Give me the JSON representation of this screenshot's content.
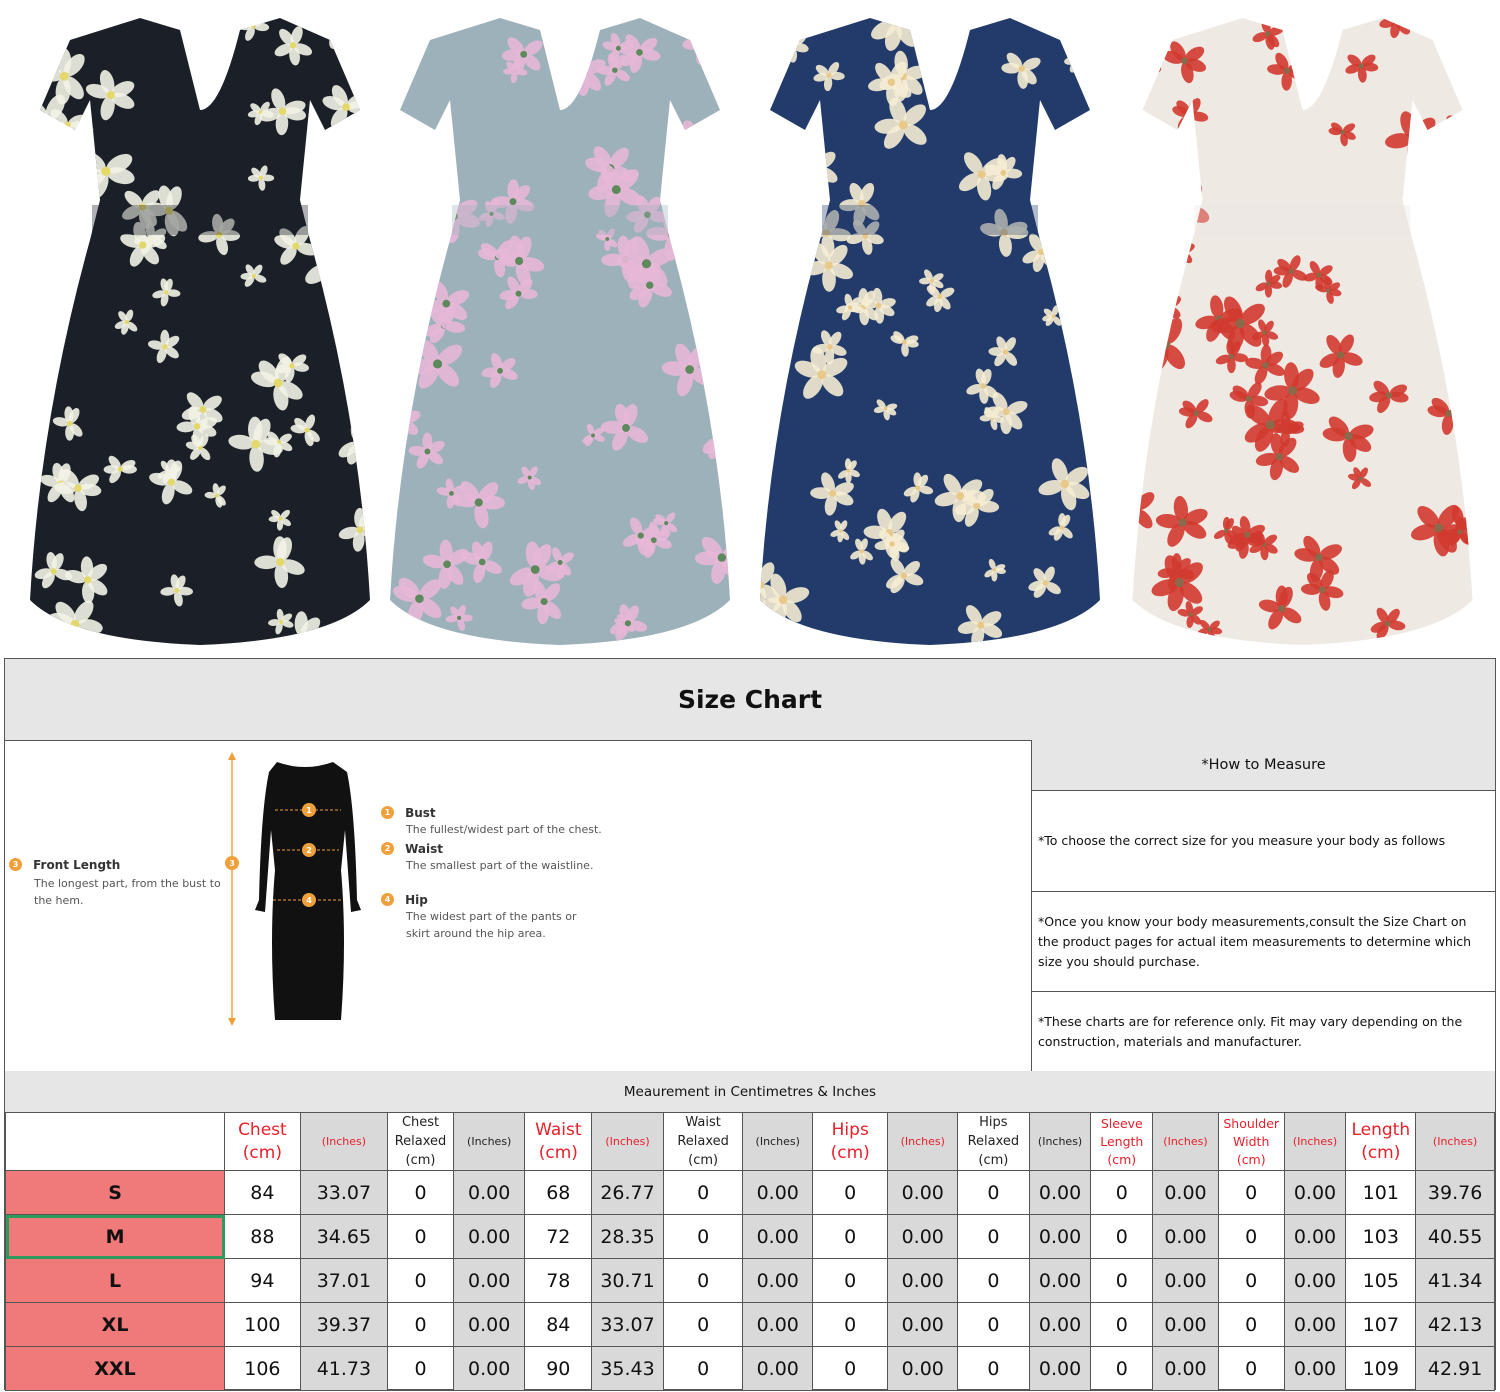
{
  "products": [
    {
      "name": "black-floral-dress",
      "base_color": "#1b2028",
      "flower_color": "#f2f2e6",
      "accent": "#e5d86a"
    },
    {
      "name": "grey-blue-floral-dress",
      "base_color": "#9db1ba",
      "flower_color": "#e8b7d8",
      "accent": "#5c8a5a"
    },
    {
      "name": "navy-floral-dress",
      "base_color": "#233b6b",
      "flower_color": "#f5ecd3",
      "accent": "#e8c98a"
    },
    {
      "name": "christmas-cat-dress",
      "base_color": "#efe9e4",
      "flower_color": "#d23a2f",
      "accent": "#8a6a4a"
    }
  ],
  "size_chart": {
    "title": "Size Chart",
    "diagram": {
      "front_length": {
        "num": "3",
        "title": "Front Length",
        "desc1": "The longest part, from the bust to",
        "desc2": "the hem."
      },
      "bust": {
        "num": "1",
        "title": "Bust",
        "desc": "The fullest/widest part of the chest."
      },
      "waist": {
        "num": "2",
        "title": "Waist",
        "desc": "The smallest part of the waistline."
      },
      "hip": {
        "num": "4",
        "title": "Hip",
        "desc1": "The widest part of the pants or",
        "desc2": "skirt around the hip area."
      }
    },
    "how_to": {
      "heading": "*How to Measure",
      "p1": "*To choose the correct size for you measure your body as follows",
      "p2": "*Once you know your body measurements,consult the Size Chart on the product pages for actual item measurements to determine which size you should purchase.",
      "p3": "*These charts are for reference only. Fit may vary depending on the construction, materials and manufacturer."
    },
    "measurement_caption": "Meaurement in Centimetres & Inches",
    "columns": [
      {
        "l1": "Chest",
        "l2": "(cm)",
        "style": "red"
      },
      {
        "l1": "(Inches)",
        "style": "inch"
      },
      {
        "l1": "Chest",
        "l2": "Relaxed",
        "l3": "(cm)",
        "style": "blk"
      },
      {
        "l1": "(Inches)",
        "style": "plaininch"
      },
      {
        "l1": "Waist",
        "l2": "(cm)",
        "style": "red"
      },
      {
        "l1": "(Inches)",
        "style": "inch"
      },
      {
        "l1": "Waist",
        "l2": "Relaxed",
        "l3": "(cm)",
        "style": "blk"
      },
      {
        "l1": "(Inches)",
        "style": "plaininch"
      },
      {
        "l1": "Hips",
        "l2": "(cm)",
        "style": "red"
      },
      {
        "l1": "(Inches)",
        "style": "inch"
      },
      {
        "l1": "Hips",
        "l2": "Relaxed",
        "l3": "(cm)",
        "style": "blk"
      },
      {
        "l1": "(Inches)",
        "style": "plaininch"
      },
      {
        "l1": "Sleeve",
        "l2": "Length",
        "l3": "(cm)",
        "style": "redsm"
      },
      {
        "l1": "(Inches)",
        "style": "inch"
      },
      {
        "l1": "Shoulder",
        "l2": "Width",
        "l3": "(cm)",
        "style": "redsm"
      },
      {
        "l1": "(Inches)",
        "style": "inch"
      },
      {
        "l1": "Length",
        "l2": "(cm)",
        "style": "red"
      },
      {
        "l1": "(Inches)",
        "style": "inch"
      }
    ],
    "selected_size": "M",
    "rows": [
      {
        "size": "S",
        "values": [
          "84",
          "33.07",
          "0",
          "0.00",
          "68",
          "26.77",
          "0",
          "0.00",
          "0",
          "0.00",
          "0",
          "0.00",
          "0",
          "0.00",
          "0",
          "0.00",
          "101",
          "39.76"
        ]
      },
      {
        "size": "M",
        "values": [
          "88",
          "34.65",
          "0",
          "0.00",
          "72",
          "28.35",
          "0",
          "0.00",
          "0",
          "0.00",
          "0",
          "0.00",
          "0",
          "0.00",
          "0",
          "0.00",
          "103",
          "40.55"
        ]
      },
      {
        "size": "L",
        "values": [
          "94",
          "37.01",
          "0",
          "0.00",
          "78",
          "30.71",
          "0",
          "0.00",
          "0",
          "0.00",
          "0",
          "0.00",
          "0",
          "0.00",
          "0",
          "0.00",
          "105",
          "41.34"
        ]
      },
      {
        "size": "XL",
        "values": [
          "100",
          "39.37",
          "0",
          "0.00",
          "84",
          "33.07",
          "0",
          "0.00",
          "0",
          "0.00",
          "0",
          "0.00",
          "0",
          "0.00",
          "0",
          "0.00",
          "107",
          "42.13"
        ]
      },
      {
        "size": "XXL",
        "values": [
          "106",
          "41.73",
          "0",
          "0.00",
          "90",
          "35.43",
          "0",
          "0.00",
          "0",
          "0.00",
          "0",
          "0.00",
          "0",
          "0.00",
          "0",
          "0.00",
          "109",
          "42.91"
        ]
      }
    ]
  }
}
